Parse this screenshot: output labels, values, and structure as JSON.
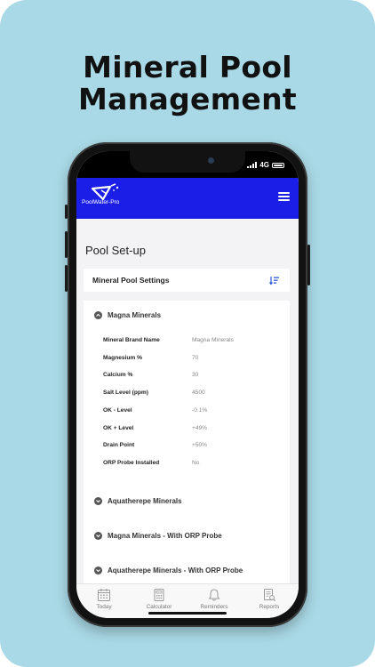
{
  "headline": {
    "line1": "Mineral Pool",
    "line2": "Management"
  },
  "status_bar": {
    "network": "4G"
  },
  "app": {
    "logo_text": "PoolWater-Pro"
  },
  "page": {
    "title": "Pool Set-up"
  },
  "section": {
    "title": "Mineral Pool Settings"
  },
  "expanded": {
    "title": "Magna Minerals",
    "fields": [
      {
        "key": "Mineral Brand Name",
        "value": "Magna Minerals"
      },
      {
        "key": "Magnesium %",
        "value": "70"
      },
      {
        "key": "Calcium %",
        "value": "30"
      },
      {
        "key": "Salt Level (ppm)",
        "value": "4500"
      },
      {
        "key": "OK - Level",
        "value": "-0.1%"
      },
      {
        "key": "OK + Level",
        "value": "+49%"
      },
      {
        "key": "Drain Point",
        "value": "+50%"
      },
      {
        "key": "ORP Probe Installed",
        "value": "No"
      }
    ]
  },
  "collapsed": [
    {
      "title": "Aquatherepe Minerals"
    },
    {
      "title": "Magna Minerals - With ORP Probe"
    },
    {
      "title": "Aquatherepe Minerals - With ORP Probe"
    }
  ],
  "tabs": [
    {
      "label": "Today",
      "icon": "calendar-icon"
    },
    {
      "label": "Calculator",
      "icon": "calculator-icon"
    },
    {
      "label": "Reminders",
      "icon": "bell-icon"
    },
    {
      "label": "Reports",
      "icon": "report-icon"
    }
  ],
  "colors": {
    "background": "#a9d9e6",
    "app_bar": "#1a1ee6",
    "accent_icon": "#2a57d6"
  }
}
